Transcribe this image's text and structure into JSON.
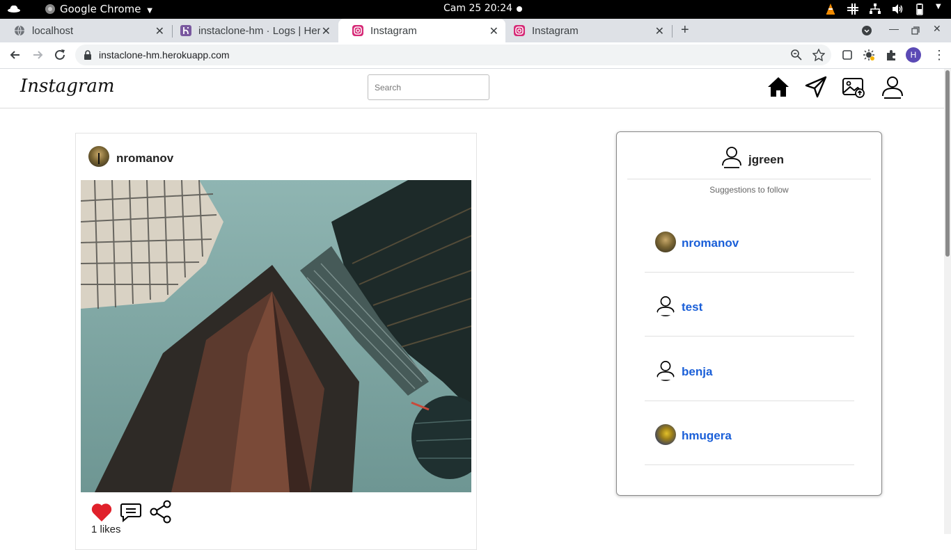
{
  "system_bar": {
    "app_name": "Google Chrome",
    "clock": "Cam 25  20:24"
  },
  "browser": {
    "tabs": [
      {
        "title": "localhost",
        "icon": "globe-icon"
      },
      {
        "title": "instaclone-hm · Logs | Her",
        "icon": "heroku-icon"
      },
      {
        "title": "Instagram",
        "icon": "instagram-icon"
      },
      {
        "title": "Instagram",
        "icon": "instagram-icon"
      }
    ],
    "url": "instaclone-hm.herokuapp.com",
    "profile_initial": "H"
  },
  "header": {
    "logo": "Instagram",
    "search_placeholder": "Search"
  },
  "post": {
    "username": "nromanov",
    "likes": "1 likes",
    "liked": true
  },
  "sidebar": {
    "current_user": "jgreen",
    "suggestions_title": "Suggestions to follow",
    "suggestions": [
      {
        "username": "nromanov",
        "avatar": "photo"
      },
      {
        "username": "test",
        "avatar": "default-user-icon"
      },
      {
        "username": "benja",
        "avatar": "default-user-icon"
      },
      {
        "username": "hmugera",
        "avatar": "photo"
      }
    ]
  },
  "colors": {
    "link": "#1a5fd8",
    "like": "#e0212b",
    "tab_strip": "#dee1e6"
  }
}
